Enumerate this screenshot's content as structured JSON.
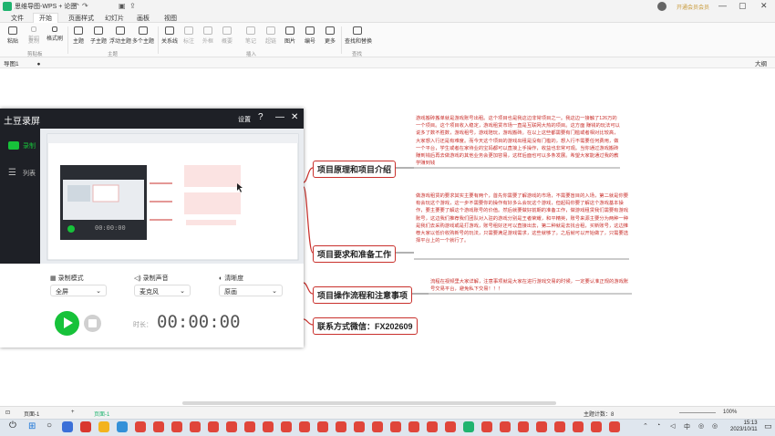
{
  "window": {
    "app_title": "思维导图-WPS + 论图",
    "tab_title": "导图1",
    "member_text": "开通会员会员",
    "min": "—",
    "max": "▢",
    "close": "✕"
  },
  "menu": [
    "文件",
    "开始",
    "页面样式",
    "幻灯片",
    "画板",
    "视图"
  ],
  "ribbon": {
    "buttons": [
      "粘贴",
      "剪切",
      "复制",
      "格式刷",
      "主题",
      "子主题",
      "浮动主题",
      "多个主题",
      "关系线",
      "标注",
      "外框",
      "概要",
      "笔记",
      "超链",
      "图片",
      "编号",
      "更多",
      "查找和替换"
    ],
    "groups": [
      "剪贴板",
      "主题",
      "插入",
      "查找"
    ]
  },
  "doc_tab": {
    "label": "导图1",
    "dot": "●"
  },
  "outline_label": "大纲",
  "mindmap": {
    "nodes": [
      "项目原理和项目介绍",
      "项目要求和准备工作",
      "项目操作流程和注意事项",
      "联系方式微信：FX202609"
    ],
    "notes": [
      "游戏搬砖搬单就是游戏账号出租。这个项目也是我这边非常项目之一。我这边一接触了126万的一个项目。这个项目收入稳定，游戏租赁市场一直是互联网大热的项目。这方面 赚钱的玩法可以说多了数不胜数，游戏租号，游戏陪玩，游戏搬砖。在以上这些都需要有门槛或者相对比较高，大家想入行还是有难度。而今天这个项目的游戏出租是没有门槛的，想入行不需要任何费用，做一个平台，学生或者在家待业的宝妈都可以直接上手操作，收益也非常可观。当你通过游戏搬砖赚到钱后再去做游戏的其他业务会更加容易，这样后面也可以多条发展。希望大家能通过我的教学赚到钱",
      "做游戏租赁的要求其实主要有两个，首先你需要了解游戏的市场，不需要盲目的入场，第二就是你要有会玩这个游戏，这一步不需要你的操作有好多么会玩这个游戏，但起码你要了解这个游戏基本操作，要主要要了解这个游戏账号的价值。然后就要做好前期的准备工作，做游戏租赁我们需要有游戏账号，这边我们推荐我们团队对入驻的游戏分别是王者荣耀，和平精英，账号来源主要分为两种一种是我们去采购游戏或是打游戏，账号租好还可以直接出去，第二种就是去找合租，买新账号，这边推荐大家以低价收购新号的玩法，只需要满足游戏需求，这些就够了。之后就可以开始做了，只需要选择平台上的一个就行了。",
      "流程在视频里大家详解，注意事项就是大家在进行游戏交易的时候，一定要认准正规的游戏账号交易平台，避免私下交易！！！"
    ]
  },
  "recorder": {
    "title": "土豆录屏",
    "settings": "设置",
    "sidebar": {
      "record": "录制",
      "list": "列表"
    },
    "preview_time": "00:00:00",
    "options": [
      {
        "label": "录制模式",
        "value": "全屏"
      },
      {
        "label": "录制声音",
        "value": "麦克风"
      },
      {
        "label": "清晰度",
        "value": "原画"
      }
    ],
    "duration_label": "时长：",
    "duration": "00:00:00"
  },
  "statusbar": {
    "page": "页面-1",
    "add": "+",
    "page_tab": "页面-1",
    "topic_count": "主题计数：8",
    "zoom": "100%"
  },
  "taskbar": {
    "time": "15:13",
    "date": "2023/10/11"
  },
  "colors": {
    "accent_red": "#c9302c",
    "brand_green": "#1fb36f",
    "rec_green": "#17c23a",
    "rec_dark": "#1e2026"
  }
}
